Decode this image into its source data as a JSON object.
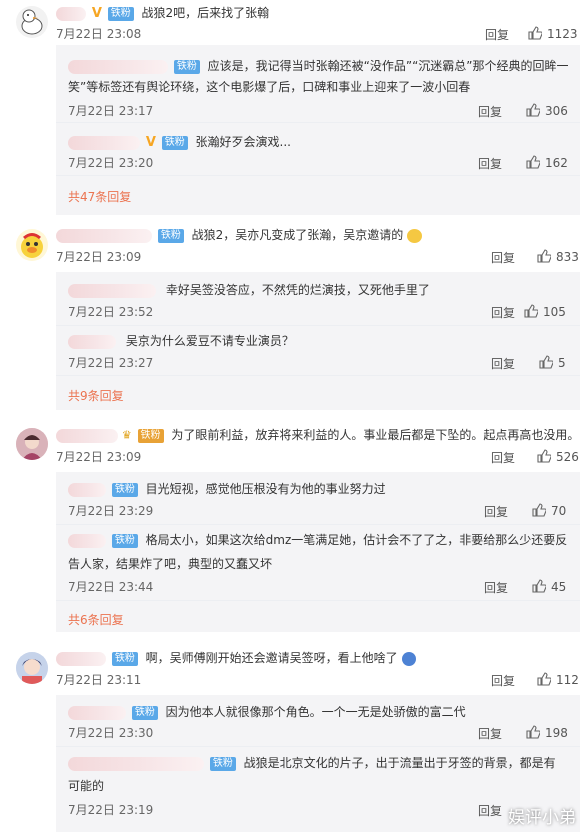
{
  "accent_colors": {
    "badge": "#5aa8e8",
    "more_link": "#eb7350",
    "v_mark": "#f6a623"
  },
  "badge_label": "铁粉",
  "reply_label": "回复",
  "like_icon": "thumbs-up-icon",
  "threads": [
    {
      "text": "战狼2吧，后来找了张翰",
      "time": "7月22日 23:08",
      "likes": "1123",
      "replies": [
        {
          "text_line1": "应该是，我记得当时张翰还被“没作品”“沉迷霸总”那个经典的回眸一",
          "text_line2": "笑”等标签还有舆论环绕，这个电影爆了后，口碑和事业上迎来了一波小回春",
          "time": "7月22日 23:17",
          "likes": "306"
        },
        {
          "text": "张瀚好歹会演戏...",
          "time": "7月22日 23:20",
          "likes": "162"
        }
      ],
      "more": "共47条回复"
    },
    {
      "text": "战狼2，吴亦凡变成了张瀚，吴京邀请的",
      "time": "7月22日 23:09",
      "likes": "833",
      "replies": [
        {
          "text": "幸好吴签没答应，不然凭的烂演技，又死他手里了",
          "time": "7月22日 23:52",
          "likes": "105"
        },
        {
          "text": "吴京为什么爱豆不请专业演员？",
          "time": "7月22日 23:27",
          "likes": "5"
        }
      ],
      "more": "共9条回复"
    },
    {
      "text": "为了眼前利益，放弃将来利益的人。事业最后都是下坠的。起点再高也没用。",
      "time": "7月22日 23:09",
      "likes": "526",
      "replies": [
        {
          "text": "目光短视，感觉他压根没有为他的事业努力过",
          "time": "7月22日 23:29",
          "likes": "70"
        },
        {
          "text_line1": "格局太小，如果这次给dmz一笔满足她，估计会不了了之，非要给那么少还要反",
          "text_line2": "告人家，结果炸了吧，典型的又蠢又坏",
          "time": "7月22日 23:44",
          "likes": "45"
        }
      ],
      "more": "共6条回复"
    },
    {
      "text": "啊，吴师傅刚开始还会邀请吴签呀，看上他啥了",
      "time": "7月22日 23:11",
      "likes": "112",
      "replies": [
        {
          "text": "因为他本人就很像那个角色。一个一无是处骄傲的富二代",
          "time": "7月22日 23:30",
          "likes": "198"
        },
        {
          "text_line1": "战狼是北京文化的片子，出于流量出于牙签的背景，都是有",
          "text_line2": "可能的",
          "time": "7月22日 23:19",
          "likes": ""
        }
      ]
    }
  ],
  "watermark": "娱评小弟"
}
